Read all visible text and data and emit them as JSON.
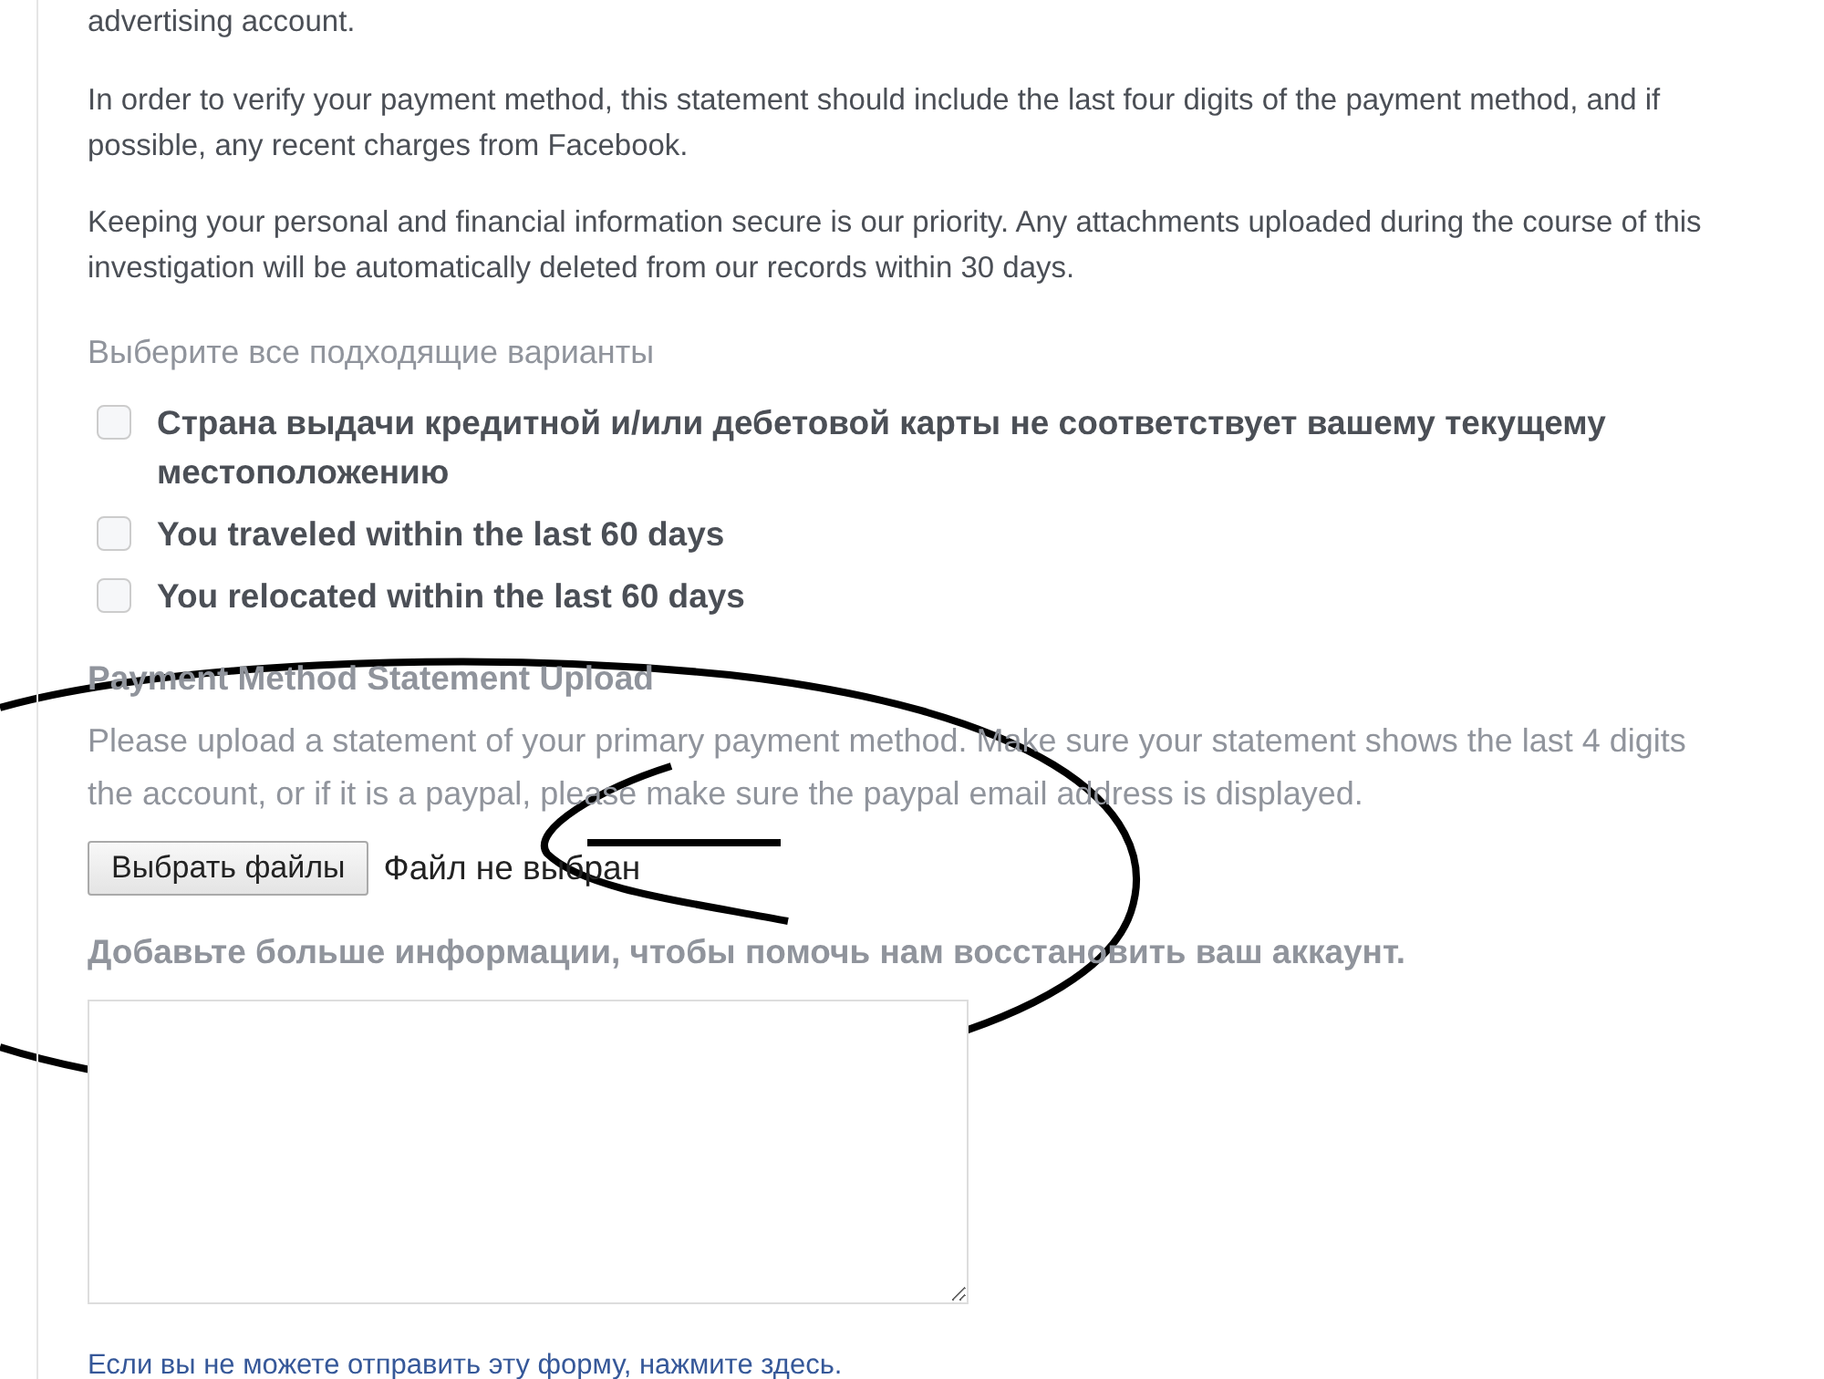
{
  "intro_tail": "advertising account.",
  "paragraphs": [
    [
      "In order to verify your payment method, this statement should include the last four digits of the payment method, and if",
      "possible, any recent charges from Facebook."
    ],
    [
      "Keeping your personal and financial information secure is our priority. Any attachments uploaded during the course of this",
      "investigation will be automatically deleted from our records within 30 days."
    ]
  ],
  "options_heading": "Выберите все подходящие варианты",
  "options": [
    {
      "label_lines": [
        "Страна выдачи кредитной и/или дебетовой карты не соответствует вашему текущему",
        "местоположению"
      ],
      "checked": false
    },
    {
      "label_lines": [
        "You traveled within the last 60 days"
      ],
      "checked": false
    },
    {
      "label_lines": [
        "You relocated within the last 60 days"
      ],
      "checked": false
    }
  ],
  "upload": {
    "heading": "Payment Method Statement Upload",
    "description_lines": [
      "Please upload a statement of your primary payment method. Make sure your statement shows the last 4 digits",
      "the account, or if it is a paypal, please make sure the paypal email address is displayed."
    ],
    "button": "Выбрать файлы",
    "file_status": "Файл не выбран"
  },
  "details_label": "Добавьте больше информации, чтобы помочь нам восстановить ваш аккаунт.",
  "footer_link": "Если вы не можете отправить эту форму, нажмите здесь."
}
